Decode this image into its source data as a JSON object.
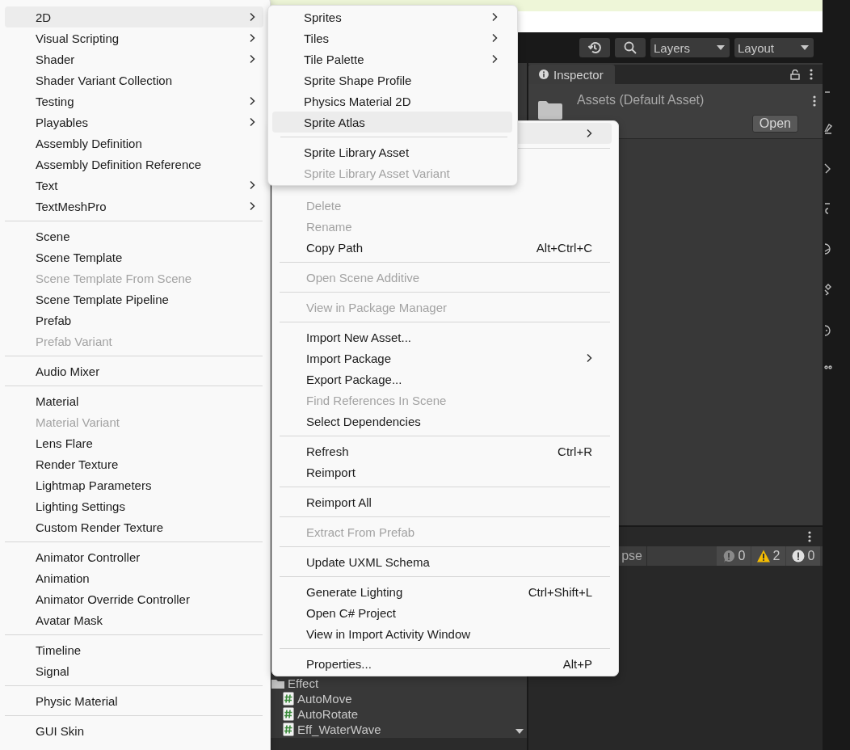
{
  "toolbar": {
    "buttons": [
      {
        "kind": "history"
      },
      {
        "kind": "search"
      }
    ],
    "dropdowns": [
      {
        "label": "Layers"
      },
      {
        "label": "Layout"
      }
    ]
  },
  "project": {
    "items": [
      {
        "kind": "folder",
        "label": "Effect"
      },
      {
        "kind": "script",
        "label": "AutoMove"
      },
      {
        "kind": "script",
        "label": "AutoRotate"
      },
      {
        "kind": "script",
        "label": "Eff_WaterWave"
      }
    ]
  },
  "inspector": {
    "tab": "Inspector",
    "asset": "Assets (Default Asset)",
    "button": "Open"
  },
  "console": {
    "filter_button": "pse",
    "counters": [
      {
        "kind": "info",
        "count": "0"
      },
      {
        "kind": "warning",
        "count": "2"
      },
      {
        "kind": "error",
        "count": "0"
      }
    ]
  },
  "create_menu": {
    "items": [
      {
        "kind": "item",
        "label": "2D",
        "submenu": true,
        "highlighted": true,
        "disabled": false
      },
      {
        "kind": "item",
        "label": "Visual Scripting",
        "submenu": true,
        "highlighted": false,
        "disabled": false
      },
      {
        "kind": "item",
        "label": "Shader",
        "submenu": true,
        "highlighted": false,
        "disabled": false
      },
      {
        "kind": "item",
        "label": "Shader Variant Collection",
        "submenu": false,
        "highlighted": false,
        "disabled": false
      },
      {
        "kind": "item",
        "label": "Testing",
        "submenu": true,
        "highlighted": false,
        "disabled": false
      },
      {
        "kind": "item",
        "label": "Playables",
        "submenu": true,
        "highlighted": false,
        "disabled": false
      },
      {
        "kind": "item",
        "label": "Assembly Definition",
        "submenu": false,
        "highlighted": false,
        "disabled": false
      },
      {
        "kind": "item",
        "label": "Assembly Definition Reference",
        "submenu": false,
        "highlighted": false,
        "disabled": false
      },
      {
        "kind": "item",
        "label": "Text",
        "submenu": true,
        "highlighted": false,
        "disabled": false
      },
      {
        "kind": "item",
        "label": "TextMeshPro",
        "submenu": true,
        "highlighted": false,
        "disabled": false
      },
      {
        "kind": "separator"
      },
      {
        "kind": "item",
        "label": "Scene",
        "submenu": false,
        "highlighted": false,
        "disabled": false
      },
      {
        "kind": "item",
        "label": "Scene Template",
        "submenu": false,
        "highlighted": false,
        "disabled": false
      },
      {
        "kind": "item",
        "label": "Scene Template From Scene",
        "submenu": false,
        "highlighted": false,
        "disabled": true
      },
      {
        "kind": "item",
        "label": "Scene Template Pipeline",
        "submenu": false,
        "highlighted": false,
        "disabled": false
      },
      {
        "kind": "item",
        "label": "Prefab",
        "submenu": false,
        "highlighted": false,
        "disabled": false
      },
      {
        "kind": "item",
        "label": "Prefab Variant",
        "submenu": false,
        "highlighted": false,
        "disabled": true
      },
      {
        "kind": "separator"
      },
      {
        "kind": "item",
        "label": "Audio Mixer",
        "submenu": false,
        "highlighted": false,
        "disabled": false
      },
      {
        "kind": "separator"
      },
      {
        "kind": "item",
        "label": "Material",
        "submenu": false,
        "highlighted": false,
        "disabled": false
      },
      {
        "kind": "item",
        "label": "Material Variant",
        "submenu": false,
        "highlighted": false,
        "disabled": true
      },
      {
        "kind": "item",
        "label": "Lens Flare",
        "submenu": false,
        "highlighted": false,
        "disabled": false
      },
      {
        "kind": "item",
        "label": "Render Texture",
        "submenu": false,
        "highlighted": false,
        "disabled": false
      },
      {
        "kind": "item",
        "label": "Lightmap Parameters",
        "submenu": false,
        "highlighted": false,
        "disabled": false
      },
      {
        "kind": "item",
        "label": "Lighting Settings",
        "submenu": false,
        "highlighted": false,
        "disabled": false
      },
      {
        "kind": "item",
        "label": "Custom Render Texture",
        "submenu": false,
        "highlighted": false,
        "disabled": false
      },
      {
        "kind": "separator"
      },
      {
        "kind": "item",
        "label": "Animator Controller",
        "submenu": false,
        "highlighted": false,
        "disabled": false
      },
      {
        "kind": "item",
        "label": "Animation",
        "submenu": false,
        "highlighted": false,
        "disabled": false
      },
      {
        "kind": "item",
        "label": "Animator Override Controller",
        "submenu": false,
        "highlighted": false,
        "disabled": false
      },
      {
        "kind": "item",
        "label": "Avatar Mask",
        "submenu": false,
        "highlighted": false,
        "disabled": false
      },
      {
        "kind": "separator"
      },
      {
        "kind": "item",
        "label": "Timeline",
        "submenu": false,
        "highlighted": false,
        "disabled": false
      },
      {
        "kind": "item",
        "label": "Signal",
        "submenu": false,
        "highlighted": false,
        "disabled": false
      },
      {
        "kind": "separator"
      },
      {
        "kind": "item",
        "label": "Physic Material",
        "submenu": false,
        "highlighted": false,
        "disabled": false
      },
      {
        "kind": "separator"
      },
      {
        "kind": "item",
        "label": "GUI Skin",
        "submenu": false,
        "highlighted": false,
        "disabled": false
      }
    ]
  },
  "context_menu": {
    "items": [
      {
        "kind": "item",
        "submenu": true,
        "highlighted": true,
        "disabled": false
      },
      {
        "kind": "separator"
      },
      {
        "kind": "item"
      },
      {
        "kind": "item",
        "label": "Delete",
        "submenu": false,
        "highlighted": false,
        "disabled": true
      },
      {
        "kind": "item",
        "label": "Rename",
        "submenu": false,
        "highlighted": false,
        "disabled": true
      },
      {
        "kind": "item",
        "label": "Copy Path",
        "shortcut": "Alt+Ctrl+C",
        "submenu": false,
        "highlighted": false,
        "disabled": false
      },
      {
        "kind": "separator"
      },
      {
        "kind": "item",
        "label": "Open Scene Additive",
        "submenu": false,
        "highlighted": false,
        "disabled": true
      },
      {
        "kind": "separator"
      },
      {
        "kind": "item",
        "label": "View in Package Manager",
        "submenu": false,
        "highlighted": false,
        "disabled": true
      },
      {
        "kind": "separator"
      },
      {
        "kind": "item",
        "label": "Import New Asset...",
        "submenu": false,
        "highlighted": false,
        "disabled": false
      },
      {
        "kind": "item",
        "label": "Import Package",
        "submenu": true,
        "highlighted": false,
        "disabled": false
      },
      {
        "kind": "item",
        "label": "Export Package...",
        "submenu": false,
        "highlighted": false,
        "disabled": false
      },
      {
        "kind": "item",
        "label": "Find References In Scene",
        "submenu": false,
        "highlighted": false,
        "disabled": true
      },
      {
        "kind": "item",
        "label": "Select Dependencies",
        "submenu": false,
        "highlighted": false,
        "disabled": false
      },
      {
        "kind": "separator"
      },
      {
        "kind": "item",
        "label": "Refresh",
        "shortcut": "Ctrl+R",
        "submenu": false,
        "highlighted": false,
        "disabled": false
      },
      {
        "kind": "item",
        "label": "Reimport",
        "submenu": false,
        "highlighted": false,
        "disabled": false
      },
      {
        "kind": "separator"
      },
      {
        "kind": "item",
        "label": "Reimport All",
        "submenu": false,
        "highlighted": false,
        "disabled": false
      },
      {
        "kind": "separator"
      },
      {
        "kind": "item",
        "label": "Extract From Prefab",
        "submenu": false,
        "highlighted": false,
        "disabled": true
      },
      {
        "kind": "separator"
      },
      {
        "kind": "item",
        "label": "Update UXML Schema",
        "submenu": false,
        "highlighted": false,
        "disabled": false
      },
      {
        "kind": "separator"
      },
      {
        "kind": "item",
        "label": "Generate Lighting",
        "shortcut": "Ctrl+Shift+L",
        "submenu": false,
        "highlighted": false,
        "disabled": false
      },
      {
        "kind": "item",
        "label": "Open C# Project",
        "submenu": false,
        "highlighted": false,
        "disabled": false
      },
      {
        "kind": "item",
        "label": "View in Import Activity Window",
        "submenu": false,
        "highlighted": false,
        "disabled": false
      },
      {
        "kind": "separator"
      },
      {
        "kind": "item",
        "label": "Properties...",
        "shortcut": "Alt+P",
        "submenu": false,
        "highlighted": false,
        "disabled": false
      }
    ]
  },
  "submenu_2d": {
    "items": [
      {
        "kind": "item",
        "label": "Sprites",
        "submenu": true,
        "highlighted": false,
        "disabled": false
      },
      {
        "kind": "item",
        "label": "Tiles",
        "submenu": true,
        "highlighted": false,
        "disabled": false
      },
      {
        "kind": "item",
        "label": "Tile Palette",
        "submenu": true,
        "highlighted": false,
        "disabled": false
      },
      {
        "kind": "item",
        "label": "Sprite Shape Profile",
        "submenu": false,
        "highlighted": false,
        "disabled": false
      },
      {
        "kind": "item",
        "label": "Physics Material 2D",
        "submenu": false,
        "highlighted": false,
        "disabled": false
      },
      {
        "kind": "item",
        "label": "Sprite Atlas",
        "submenu": false,
        "highlighted": true,
        "disabled": false
      },
      {
        "kind": "separator"
      },
      {
        "kind": "item",
        "label": "Sprite Library Asset",
        "submenu": false,
        "highlighted": false,
        "disabled": false
      },
      {
        "kind": "item",
        "label": "Sprite Library Asset Variant",
        "submenu": false,
        "highlighted": false,
        "disabled": true
      }
    ]
  }
}
